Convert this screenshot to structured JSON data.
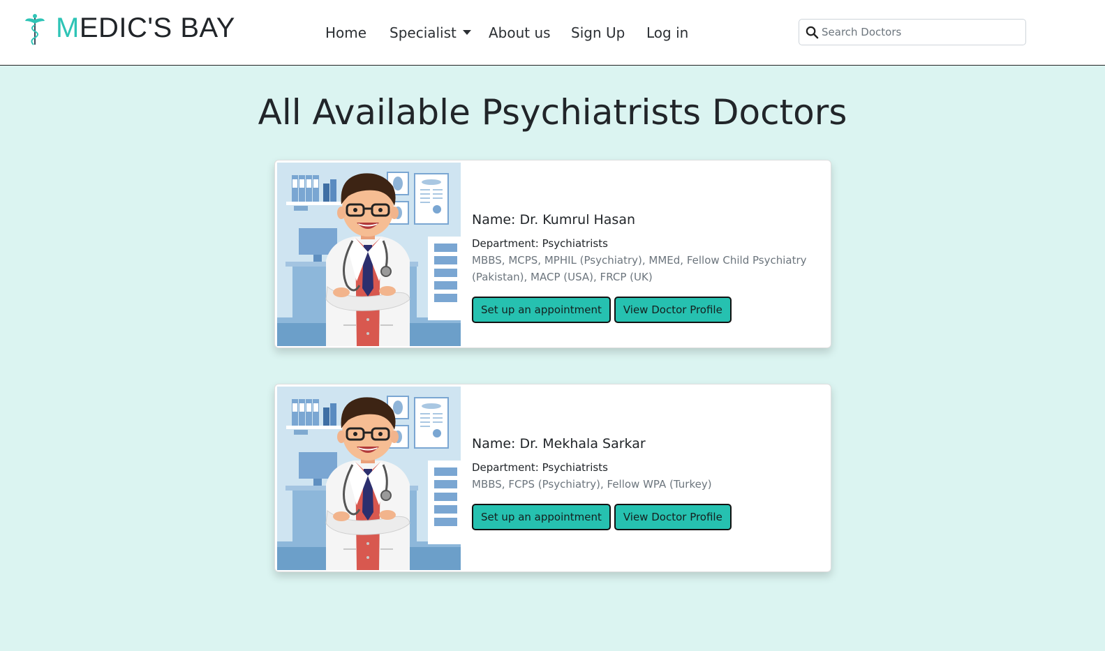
{
  "brand": {
    "first_letter": "M",
    "rest": "EDIC'S BAY"
  },
  "nav": {
    "home": "Home",
    "specialist": "Specialist",
    "about": "About us",
    "signup": "Sign Up",
    "login": "Log in"
  },
  "search": {
    "placeholder": "Search Doctors",
    "value": ""
  },
  "page": {
    "title": "All Available Psychiatrists Doctors"
  },
  "doctors": [
    {
      "name": "Name: Dr. Kumrul Hasan",
      "department": "Department: Psychiatrists",
      "qualifications": "MBBS, MCPS, MPHIL (Psychiatry), MMEd, Fellow Child Psychiatry (Pakistan), MACP (USA), FRCP (UK)",
      "appointment_label": "Set up an appointment",
      "profile_label": "View Doctor Profile"
    },
    {
      "name": "Name: Dr. Mekhala Sarkar",
      "department": "Department: Psychiatrists",
      "qualifications": "MBBS, FCPS (Psychiatry), Fellow WPA (Turkey)",
      "appointment_label": "Set up an appointment",
      "profile_label": "View Doctor Profile"
    }
  ],
  "colors": {
    "accent": "#2ec4b6",
    "button": "#26c1b0",
    "page_bg": "#dbf4f1"
  },
  "icons": {
    "logo": "caduceus-icon",
    "search": "search-icon",
    "dropdown": "caret-down-icon"
  }
}
